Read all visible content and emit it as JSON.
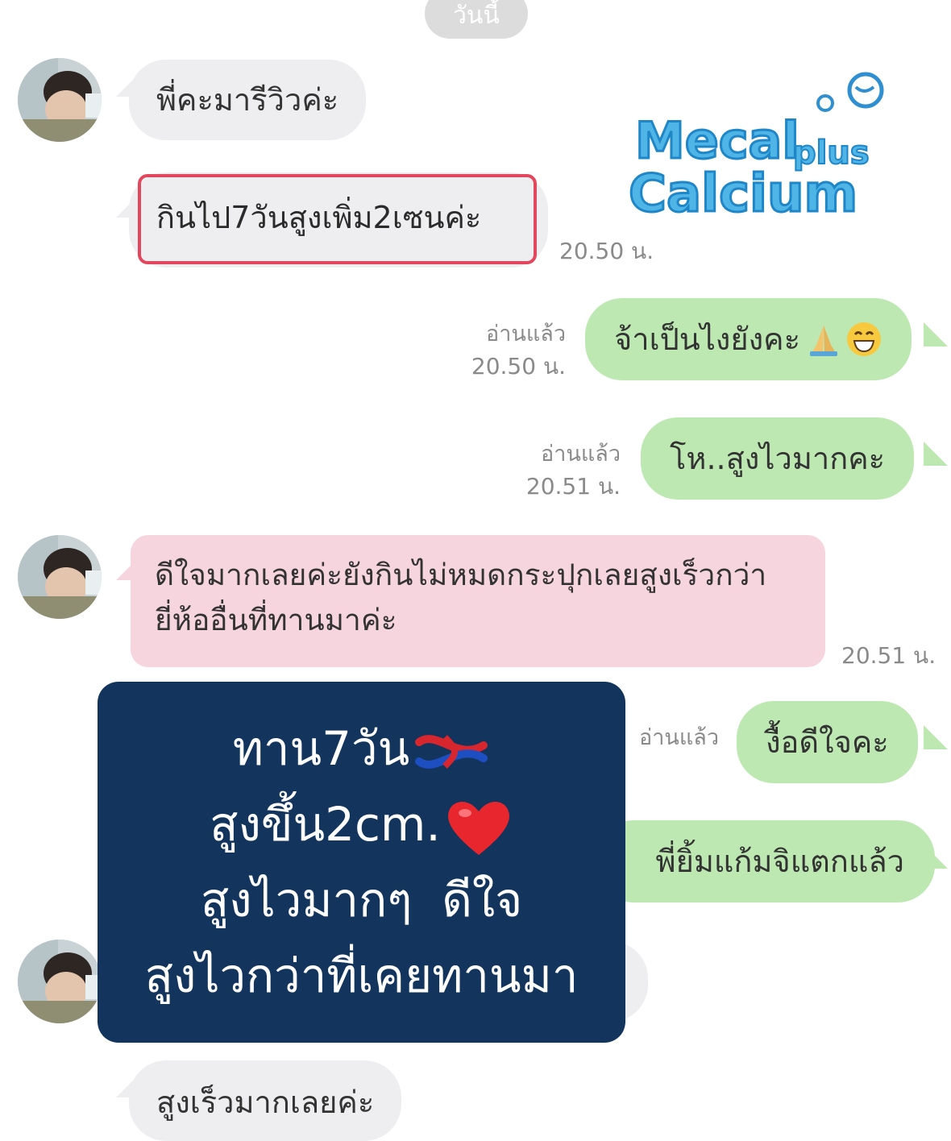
{
  "date_label": "วันนี้",
  "brand": {
    "name": "Mecal",
    "plus": "plus",
    "sub": "Calcium",
    "colors": {
      "fill": "#4fb5e6",
      "stroke": "#1f86c8"
    }
  },
  "messages": [
    {
      "side": "in",
      "text": "พี่คะมารีวิวค่ะ"
    },
    {
      "side": "in",
      "text": "กินไป7วันสูงเพิ่ม2เซนค่ะ",
      "time": "20.50 น.",
      "highlighted": true
    },
    {
      "side": "out",
      "text": "จ้าเป็นไงยังคะ",
      "status": "อ่านแล้ว",
      "time": "20.50 น.",
      "emoji": [
        "folded-hands",
        "grinning-face"
      ]
    },
    {
      "side": "out",
      "text": "โห..สูงไวมากคะ",
      "status": "อ่านแล้ว",
      "time": "20.51 น."
    },
    {
      "side": "in",
      "text": "ดีใจมากเลยค่ะยังกินไม่หมดกระปุกเลยสูงเร็วกว่ายี่ห้ออื่นที่ทานมาค่ะ",
      "time": "20.51 น."
    },
    {
      "side": "out",
      "text": "งื้อดีใจคะ",
      "status": "อ่านแล้ว"
    },
    {
      "side": "out",
      "text": "พี่ยิ้มแก้มจิแตกแล้ว"
    },
    {
      "side": "in",
      "text": "สูงเร็วมากเลยค่ะ"
    }
  ],
  "overlay": {
    "line1": "ทาน7วัน",
    "line2": "สูงขึ้น2cm.",
    "line3": "สูงไวมากๆ  ดีใจ",
    "line4": "สูงไวกว่าที่เคยทานมา",
    "emoji": [
      "knot",
      "red-heart"
    ],
    "background": "#13345c"
  },
  "colors": {
    "incoming_bubble": "#eeeef1",
    "outgoing_bubble": "#bde8b2",
    "pink_bubble": "#f6d5df",
    "highlight_border": "#e2475d"
  }
}
